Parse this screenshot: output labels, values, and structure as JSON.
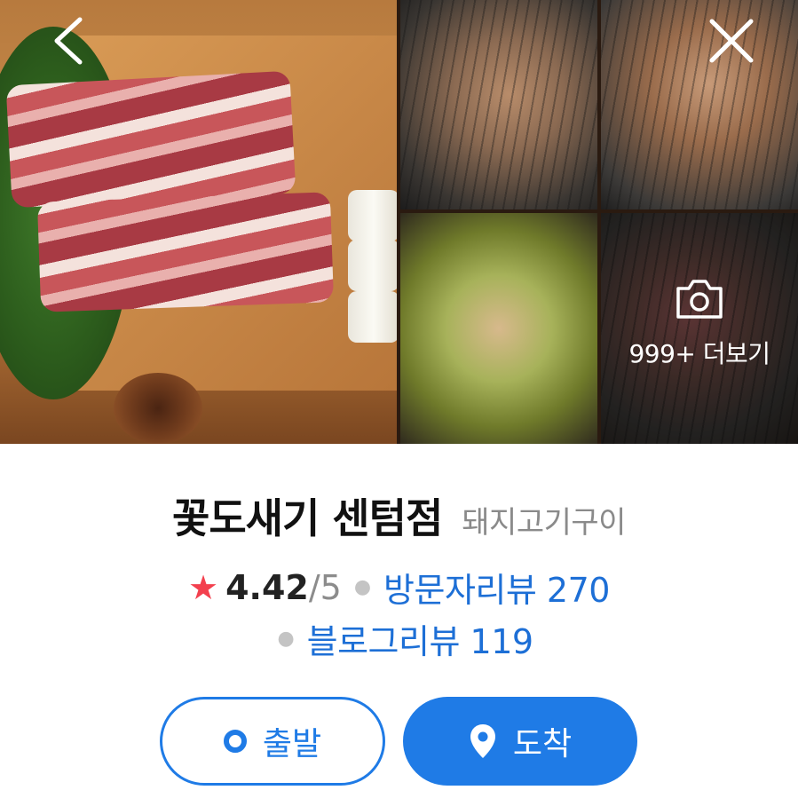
{
  "gallery": {
    "photos": [
      {
        "description_icon": "pork-belly-photo"
      },
      {
        "description_icon": "grilled-pork-photo"
      },
      {
        "description_icon": "grilled-meat-photo"
      },
      {
        "description_icon": "pork-with-scallion-photo"
      },
      {
        "description_icon": "raw-meat-on-grill-photo"
      }
    ],
    "more_label": "999+ 더보기",
    "back_icon": "chevron-left-icon",
    "close_icon": "close-icon",
    "camera_icon": "camera-icon"
  },
  "place": {
    "name": "꽃도새기 센텀점",
    "category": "돼지고기구이"
  },
  "rating": {
    "star": "★",
    "score": "4.42",
    "max": "/5",
    "visitor_review": "방문자리뷰 270",
    "blog_review": "블로그리뷰 119"
  },
  "actions": {
    "depart_label": "출발",
    "arrive_label": "도착"
  },
  "colors": {
    "accent": "#1f7be6",
    "star": "#f3404e",
    "link": "#1d6fd6",
    "muted": "#8a8a8a"
  }
}
